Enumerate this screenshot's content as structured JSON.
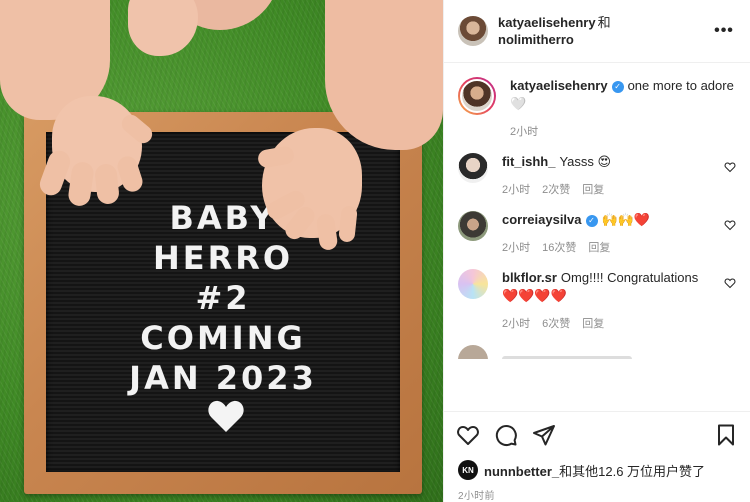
{
  "photo": {
    "board_lines": [
      "BABY",
      "HERRO",
      "#2",
      "COMING",
      "JAN 2023"
    ]
  },
  "header": {
    "user1": "katyaelisehenry",
    "and": "和",
    "user2": "nolimitherro",
    "more": "•••"
  },
  "caption": {
    "user": "katyaelisehenry",
    "text": "one more to adore 🤍",
    "time": "2小时"
  },
  "comments": [
    {
      "user": "fit_ishh_",
      "text": "Yasss 😍",
      "time": "2小时",
      "likes": "2次赞",
      "reply": "回复"
    },
    {
      "user": "correiaysilva",
      "text": "🙌🙌❤️",
      "time": "2小时",
      "likes": "16次赞",
      "reply": "回复"
    },
    {
      "user": "blkflor.sr",
      "text": "Omg!!!! Congratulations ❤️❤️❤️❤️",
      "time": "2小时",
      "likes": "6次赞",
      "reply": "回复"
    }
  ],
  "likes": {
    "badge": "KN",
    "user": "nunnbetter_",
    "rest": "和其他12.6 万位用户赞了"
  },
  "footer": {
    "time": "2小时前"
  },
  "icons": [
    "more-icon",
    "verified-icon",
    "heart-icon",
    "comment-icon",
    "share-icon",
    "bookmark-icon"
  ]
}
